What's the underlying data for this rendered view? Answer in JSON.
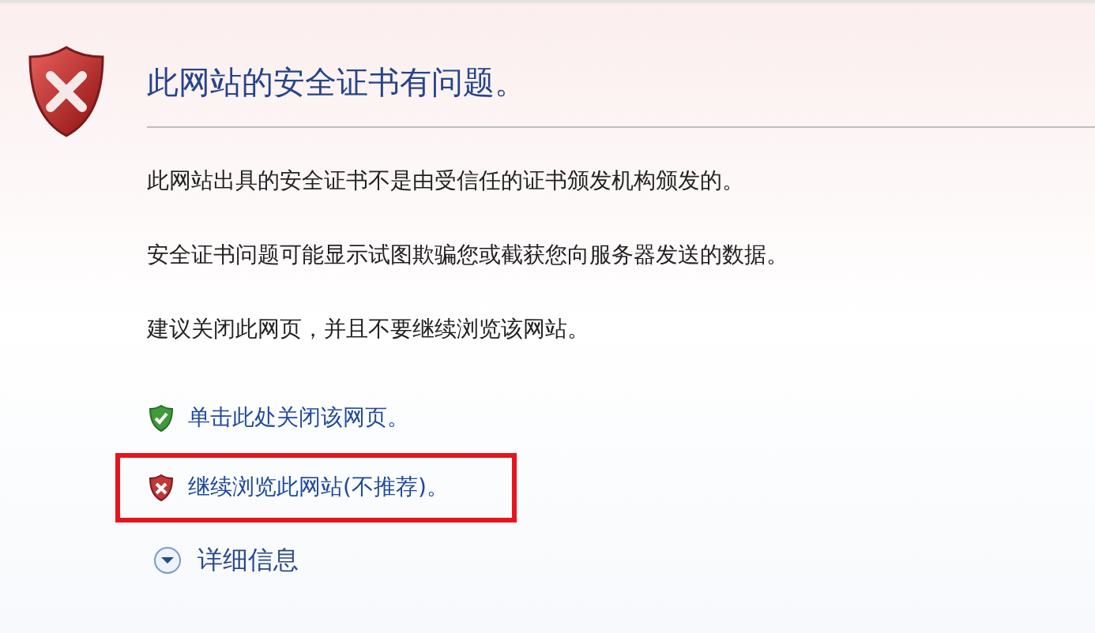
{
  "title": "此网站的安全证书有问题。",
  "paragraphs": [
    "此网站出具的安全证书不是由受信任的证书颁发机构颁发的。",
    "安全证书问题可能显示试图欺骗您或截获您向服务器发送的数据。",
    "建议关闭此网页，并且不要继续浏览该网站。"
  ],
  "links": [
    {
      "kind": "safe",
      "label": "单击此处关闭该网页。",
      "highlighted": false
    },
    {
      "kind": "unsafe",
      "label": "继续浏览此网站(不推荐)。",
      "highlighted": true
    }
  ],
  "details": {
    "label": "详细信息",
    "expanded": false
  }
}
